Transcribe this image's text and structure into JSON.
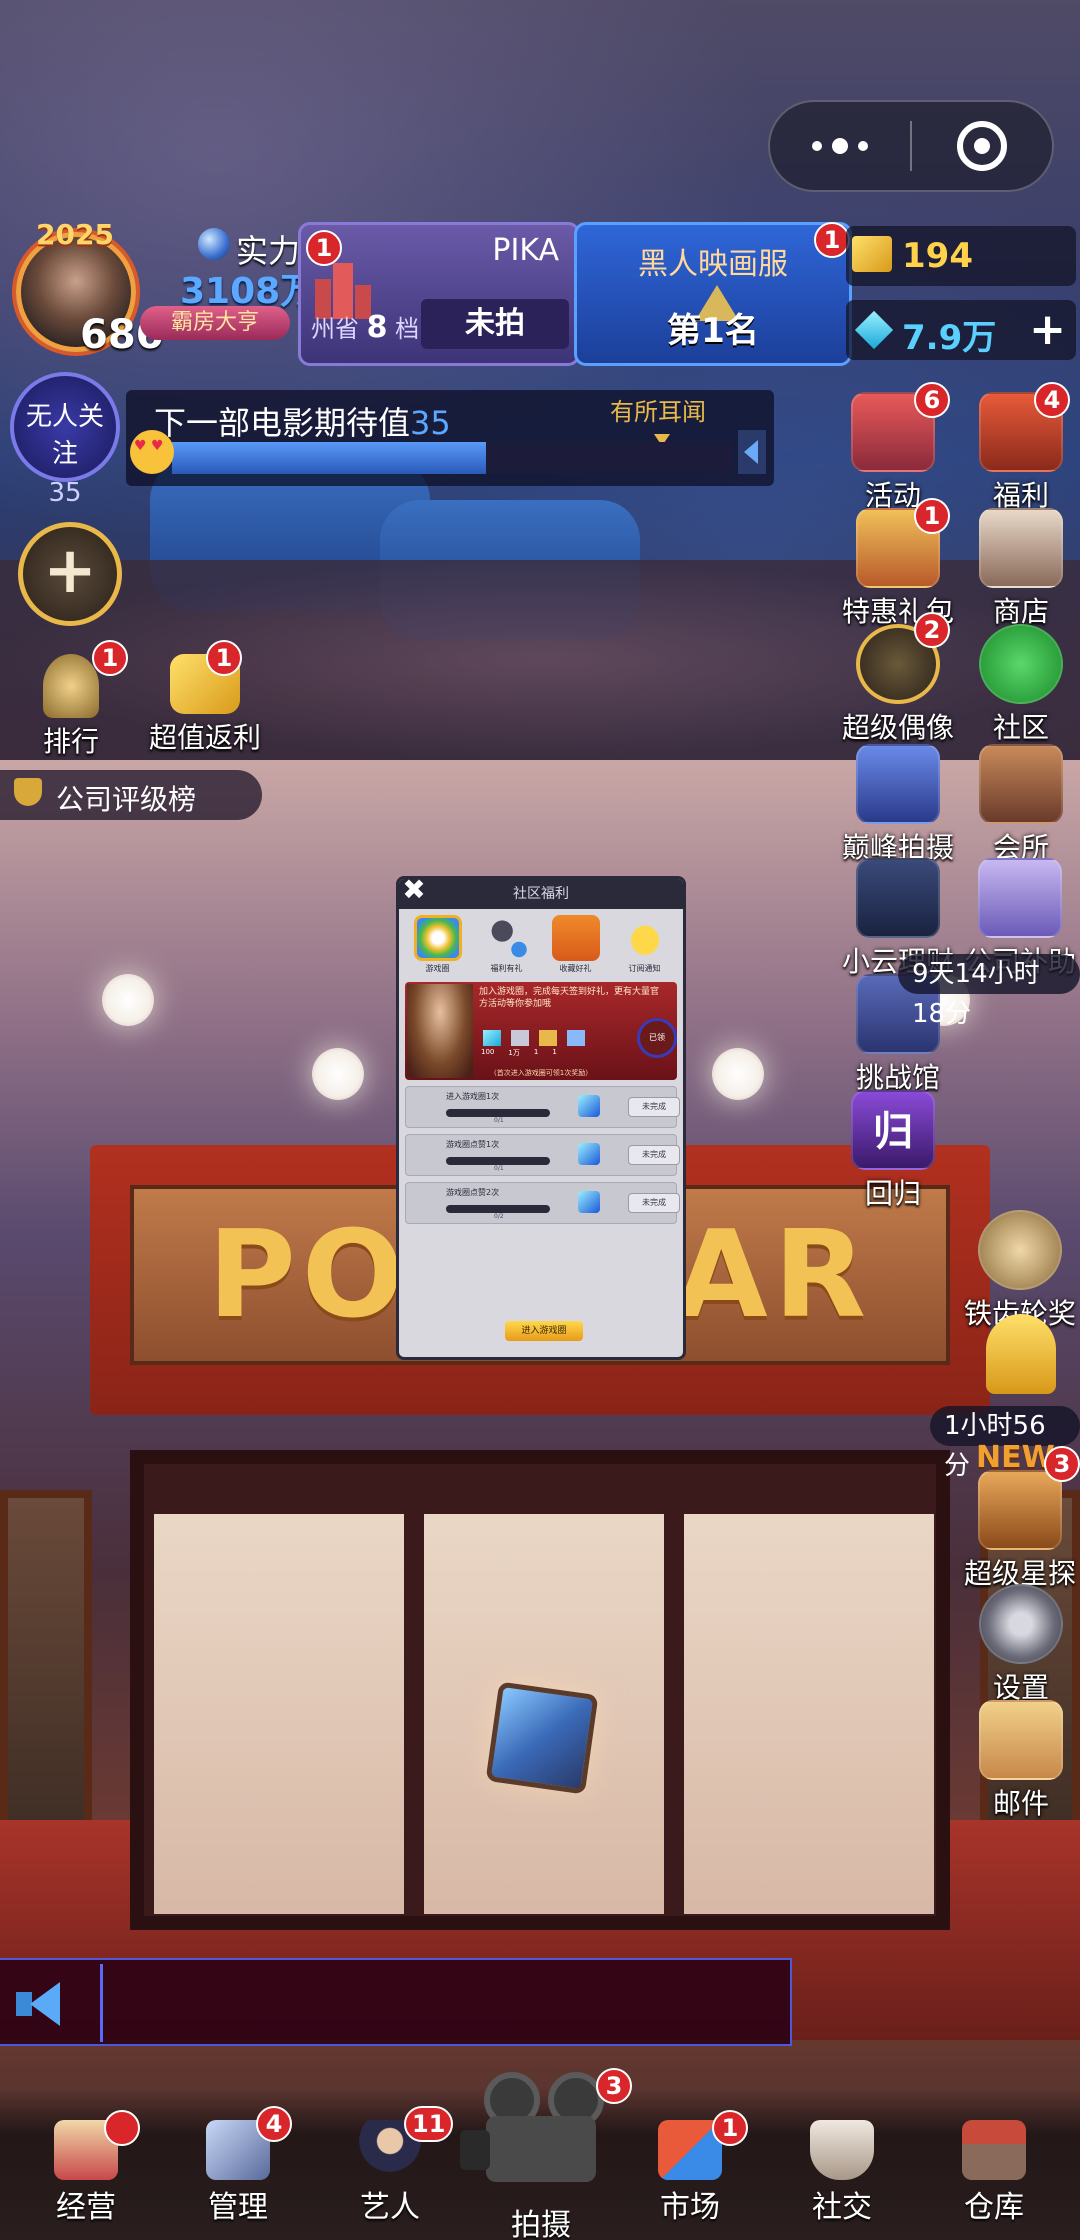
{
  "hud": {
    "avatar_year": "2025",
    "level": "686",
    "strength_label": "实力",
    "strength_value": "3108万",
    "title_badge": "霸房大亨",
    "avatar_badge": "1"
  },
  "company": {
    "name": "PIKA",
    "location_prefix": "州省",
    "location_num": "8",
    "location_suffix": "档",
    "status": "未拍",
    "badge": "1"
  },
  "server": {
    "name": "黑人映画服",
    "rank": "第1名",
    "badge": "1"
  },
  "currencies": {
    "tickets": "194",
    "gems": "7.9万",
    "plus": "+"
  },
  "attention": {
    "label": "无人关注",
    "value": "35"
  },
  "expectation": {
    "label": "下一部电影期待值",
    "value": "35",
    "hint": "有所耳闻",
    "fill_percent": 56
  },
  "left_icons": [
    {
      "label": "排行",
      "badge": "1"
    },
    {
      "label": "超值返利",
      "badge": "1"
    }
  ],
  "rating_tag": "公司评级榜",
  "right_icons_col1": [
    {
      "label": "活动",
      "badge": "6"
    },
    {
      "label": "特惠礼包",
      "badge": "1"
    },
    {
      "label": "超级偶像",
      "badge": "2"
    },
    {
      "label": "巅峰拍摄",
      "badge": ""
    },
    {
      "label": "小云理财",
      "badge": ""
    },
    {
      "label": "挑战馆",
      "badge": ""
    },
    {
      "label": "回归",
      "badge": ""
    }
  ],
  "right_icons_col2": [
    {
      "label": "福利",
      "badge": "4"
    },
    {
      "label": "商店",
      "badge": ""
    },
    {
      "label": "社区",
      "badge": ""
    },
    {
      "label": "会所",
      "badge": ""
    },
    {
      "label": "公司补助",
      "badge": ""
    },
    {
      "label": "铁齿轮奖",
      "badge": ""
    },
    {
      "label": "超级星探",
      "badge": "3"
    },
    {
      "label": "设置",
      "badge": ""
    },
    {
      "label": "邮件",
      "badge": ""
    }
  ],
  "timers": {
    "subsidy": "9天14小时18分",
    "trophy": "1小时56分",
    "new_tag": "NEW"
  },
  "marquee": "POPSTAR",
  "popup": {
    "title": "社区福利",
    "close": "✖",
    "tabs": [
      "游戏圈",
      "福利有礼",
      "收藏好礼",
      "订阅通知"
    ],
    "banner_text": "加入游戏圈，完成每天签到好礼，更有大量官方活动等你参加哦",
    "banner_values": [
      "100",
      "1万",
      "1",
      "1"
    ],
    "banner_seal": "已领",
    "banner_footer": "（首次进入游戏圈可领1次奖励）",
    "tasks": [
      {
        "name": "进入游戏圈1次",
        "progress": "0/1",
        "button": "未完成"
      },
      {
        "name": "游戏圈点赞1次",
        "progress": "0/1",
        "button": "未完成"
      },
      {
        "name": "游戏圈点赞2次",
        "progress": "0/2",
        "button": "未完成"
      }
    ],
    "enter_button": "进入游戏圈"
  },
  "nav": {
    "items": [
      {
        "label": "经营",
        "badge": ""
      },
      {
        "label": "管理",
        "badge": "4"
      },
      {
        "label": "艺人",
        "badge": "11"
      },
      {
        "label": "拍摄",
        "badge": "3"
      },
      {
        "label": "市场",
        "badge": "1"
      },
      {
        "label": "社交",
        "badge": ""
      },
      {
        "label": "仓库",
        "badge": ""
      }
    ]
  },
  "colors": {
    "accent_gold": "#e8b84a",
    "badge_red": "#d8262a",
    "server_blue": "#2f66d8",
    "company_purple": "#6a5aa8"
  }
}
